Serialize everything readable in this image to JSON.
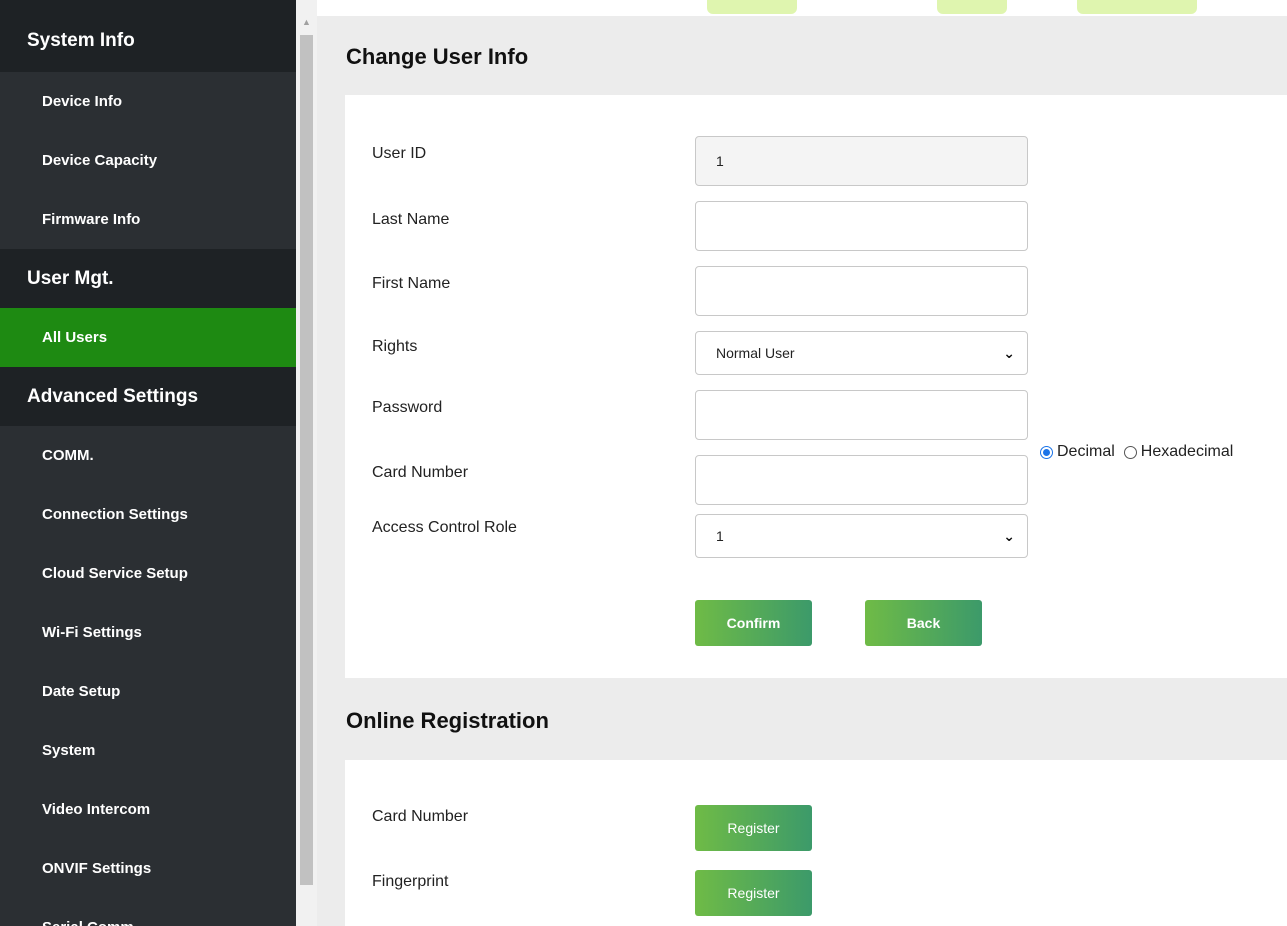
{
  "sidebar": {
    "sections": [
      {
        "title": "System Info",
        "items": [
          "Device Info",
          "Device Capacity",
          "Firmware Info"
        ]
      },
      {
        "title": "User Mgt.",
        "items": [
          "All Users"
        ]
      },
      {
        "title": "Advanced Settings",
        "items": [
          "COMM.",
          "Connection Settings",
          "Cloud Service Setup",
          "Wi-Fi Settings",
          "Date Setup",
          "System",
          "Video Intercom",
          "ONVIF Settings",
          "Serial Comm."
        ]
      }
    ],
    "active_item": "All Users",
    "active_color": "#1e8a12"
  },
  "change_user": {
    "title": "Change User Info",
    "user_id": {
      "label": "User ID",
      "value": "1"
    },
    "last_name": {
      "label": "Last Name",
      "value": ""
    },
    "first_name": {
      "label": "First Name",
      "value": ""
    },
    "rights": {
      "label": "Rights",
      "value": "Normal User"
    },
    "password": {
      "label": "Password",
      "value": ""
    },
    "card_number": {
      "label": "Card Number",
      "value": "",
      "format_options": [
        "Decimal",
        "Hexadecimal"
      ],
      "selected_format": "Decimal"
    },
    "access_control_role": {
      "label": "Access Control Role",
      "value": "1"
    },
    "confirm_label": "Confirm",
    "back_label": "Back"
  },
  "online_registration": {
    "title": "Online Registration",
    "rows": [
      {
        "label": "Card Number",
        "button": "Register"
      },
      {
        "label": "Fingerprint",
        "button": "Register"
      }
    ]
  },
  "colors": {
    "button_gradient_start": "#6fbb46",
    "button_gradient_end": "#3c9a6a",
    "radio_selected": "#1a73e8"
  },
  "icons": {
    "select_arrow": "chevron-down-icon",
    "scroll_up": "scroll-up-arrow-icon"
  }
}
